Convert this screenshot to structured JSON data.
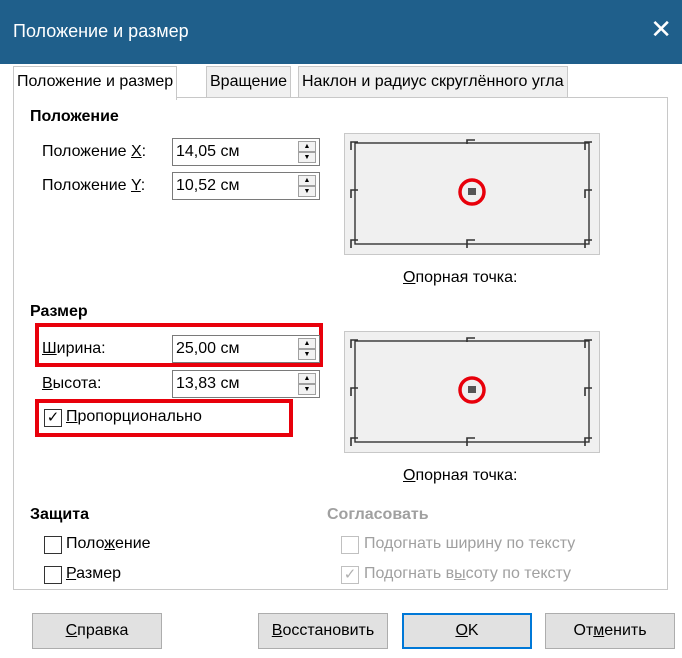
{
  "window": {
    "title": "Положение и размер"
  },
  "tabs": [
    {
      "label": "Положение и размер"
    },
    {
      "label": "Вращение"
    },
    {
      "label": "Наклон и радиус скруглённого угла"
    }
  ],
  "position": {
    "title": "Положение",
    "x_label_pre": "Положение ",
    "x_label_ul": "X",
    "x_label_post": ":",
    "x_value": "14,05 см",
    "y_label_pre": "Положение ",
    "y_label_ul": "Y",
    "y_label_post": ":",
    "y_value": "10,52 см",
    "ref_caption_ul": "О",
    "ref_caption_rest": "порная точка:"
  },
  "size": {
    "title": "Размер",
    "width_label_ul": "Ш",
    "width_label_rest": "ирина:",
    "width_value": "25,00 см",
    "height_label_ul": "В",
    "height_label_rest": "ысота:",
    "height_value": "13,83 см",
    "keep_ratio_ul": "П",
    "keep_ratio_rest": "ропорционально",
    "keep_ratio_checked": true,
    "ref_caption_ul": "О",
    "ref_caption_rest": "порная точка:"
  },
  "protect": {
    "title": "Защита",
    "position_pre": "Поло",
    "position_ul": "ж",
    "position_post": "ение",
    "position_checked": false,
    "size_ul": "Р",
    "size_rest": "азмер",
    "size_checked": false
  },
  "adapt": {
    "title": "Согласовать",
    "fit_width": "Подогнать ширину по тексту",
    "fit_width_checked": false,
    "fit_height_pre": "Подогнать в",
    "fit_height_ul": "ы",
    "fit_height_post": "соту по тексту",
    "fit_height_checked": true
  },
  "buttons": {
    "help_ul": "С",
    "help_rest": "правка",
    "reset_ul": "В",
    "reset_rest": "осстановить",
    "ok_ul": "О",
    "ok_rest": "K",
    "cancel_pre": "От",
    "cancel_ul": "м",
    "cancel_post": "енить"
  },
  "icons": {
    "close": "✕",
    "check": "✓",
    "spin_up": "▲",
    "spin_down": "▼"
  },
  "colors": {
    "titlebar": "#1f5f8b",
    "highlight": "#e8000b",
    "default_button_border": "#0078d7"
  }
}
